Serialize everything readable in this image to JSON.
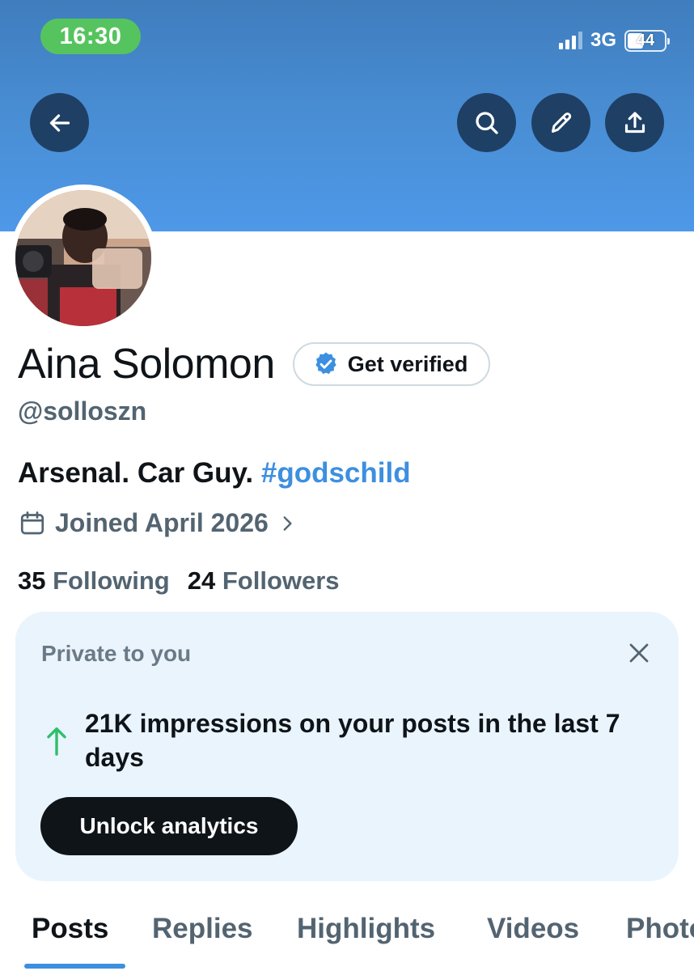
{
  "status_bar": {
    "time": "16:30",
    "network": "3G",
    "battery": "44",
    "battery_fraction": 0.44
  },
  "header": {
    "icons": [
      "back-arrow-icon",
      "search-icon",
      "edit-pencil-icon",
      "share-icon"
    ]
  },
  "profile": {
    "name": "Aina Solomon",
    "verify_label": "Get verified",
    "handle": "@solloszn",
    "bio_text": "Arsenal. Car Guy. ",
    "bio_hashtag": "#godschild",
    "joined": "Joined April 2026",
    "following_count": "35",
    "following_label": "Following",
    "followers_count": "24",
    "followers_label": "Followers"
  },
  "analytics_card": {
    "private_label": "Private to you",
    "stat_text": "21K impressions on your posts in the last 7 days",
    "unlock_label": "Unlock analytics"
  },
  "tabs": [
    "Posts",
    "Replies",
    "Highlights",
    "Videos",
    "Photos"
  ],
  "colors": {
    "banner": "#4a8fd6",
    "status_pill": "#56c45e",
    "accent": "#3d8fe0",
    "card_bg": "#eaf4fd",
    "trend_up": "#2fbf6b"
  }
}
